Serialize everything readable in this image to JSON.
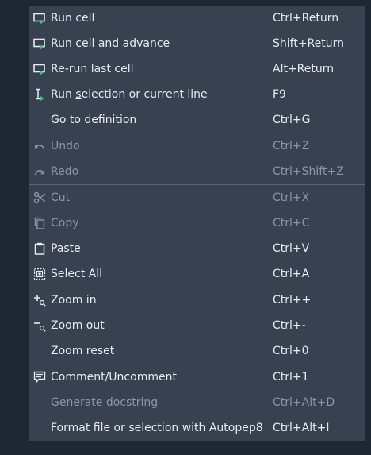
{
  "menu": {
    "items": [
      {
        "label": "Run cell",
        "shortcut": "Ctrl+Return",
        "icon": "run-cell-icon",
        "enabled": true
      },
      {
        "label": "Run cell and advance",
        "shortcut": "Shift+Return",
        "icon": "run-cell-advance-icon",
        "enabled": true
      },
      {
        "label": "Re-run last cell",
        "shortcut": "Alt+Return",
        "icon": "rerun-cell-icon",
        "enabled": true
      },
      {
        "label_pre": "Run ",
        "label_mnemonic": "s",
        "label_post": "election or current line",
        "shortcut": "F9",
        "icon": "run-selection-icon",
        "enabled": true
      },
      {
        "label": "Go to definition",
        "shortcut": "Ctrl+G",
        "enabled": true
      },
      {
        "label": "Undo",
        "shortcut": "Ctrl+Z",
        "icon": "undo-icon",
        "enabled": false
      },
      {
        "label": "Redo",
        "shortcut": "Ctrl+Shift+Z",
        "icon": "redo-icon",
        "enabled": false
      },
      {
        "label": "Cut",
        "shortcut": "Ctrl+X",
        "icon": "scissors-icon",
        "enabled": false
      },
      {
        "label": "Copy",
        "shortcut": "Ctrl+C",
        "icon": "copy-icon",
        "enabled": false
      },
      {
        "label": "Paste",
        "shortcut": "Ctrl+V",
        "icon": "clipboard-icon",
        "enabled": true
      },
      {
        "label": "Select All",
        "shortcut": "Ctrl+A",
        "icon": "select-all-icon",
        "enabled": true
      },
      {
        "label": "Zoom in",
        "shortcut": "Ctrl++",
        "icon": "zoom-in-icon",
        "enabled": true
      },
      {
        "label": "Zoom out",
        "shortcut": "Ctrl+-",
        "icon": "zoom-out-icon",
        "enabled": true
      },
      {
        "label": "Zoom reset",
        "shortcut": "Ctrl+0",
        "enabled": true
      },
      {
        "label": "Comment/Uncomment",
        "shortcut": "Ctrl+1",
        "icon": "comment-icon",
        "enabled": true
      },
      {
        "label": "Generate docstring",
        "shortcut": "Ctrl+Alt+D",
        "enabled": false
      },
      {
        "label": "Format file or selection with Autopep8",
        "shortcut": "Ctrl+Alt+I",
        "enabled": true
      }
    ]
  },
  "colors": {
    "background": "#1f2832",
    "menu_background": "#37414f",
    "text": "#e6ebf0",
    "disabled_text": "#8d97a3",
    "accent_green": "#2fc878",
    "separator": "#5a6573"
  }
}
